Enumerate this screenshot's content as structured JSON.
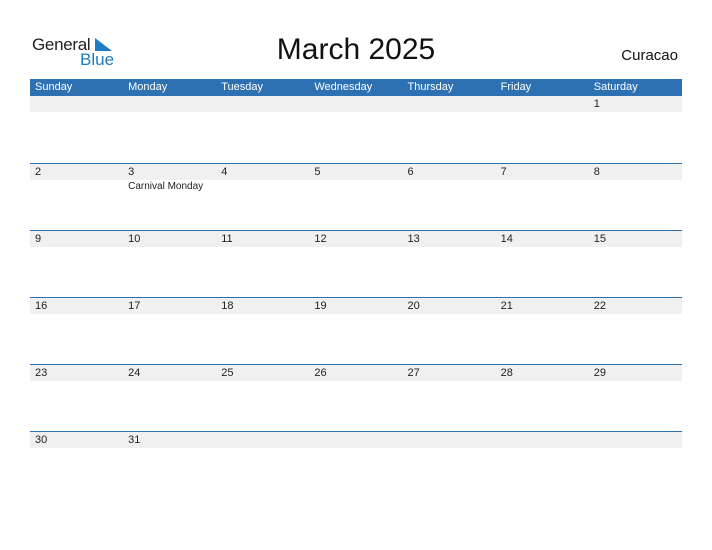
{
  "logo": {
    "line1": "General",
    "line2": "Blue"
  },
  "title": "March 2025",
  "country": "Curacao",
  "weekdays": [
    "Sunday",
    "Monday",
    "Tuesday",
    "Wednesday",
    "Thursday",
    "Friday",
    "Saturday"
  ],
  "weeks": [
    [
      {
        "d": ""
      },
      {
        "d": ""
      },
      {
        "d": ""
      },
      {
        "d": ""
      },
      {
        "d": ""
      },
      {
        "d": ""
      },
      {
        "d": "1"
      }
    ],
    [
      {
        "d": "2"
      },
      {
        "d": "3",
        "h": "Carnival Monday"
      },
      {
        "d": "4"
      },
      {
        "d": "5"
      },
      {
        "d": "6"
      },
      {
        "d": "7"
      },
      {
        "d": "8"
      }
    ],
    [
      {
        "d": "9"
      },
      {
        "d": "10"
      },
      {
        "d": "11"
      },
      {
        "d": "12"
      },
      {
        "d": "13"
      },
      {
        "d": "14"
      },
      {
        "d": "15"
      }
    ],
    [
      {
        "d": "16"
      },
      {
        "d": "17"
      },
      {
        "d": "18"
      },
      {
        "d": "19"
      },
      {
        "d": "20"
      },
      {
        "d": "21"
      },
      {
        "d": "22"
      }
    ],
    [
      {
        "d": "23"
      },
      {
        "d": "24"
      },
      {
        "d": "25"
      },
      {
        "d": "26"
      },
      {
        "d": "27"
      },
      {
        "d": "28"
      },
      {
        "d": "29"
      }
    ],
    [
      {
        "d": "30"
      },
      {
        "d": "31"
      },
      {
        "d": ""
      },
      {
        "d": ""
      },
      {
        "d": ""
      },
      {
        "d": ""
      },
      {
        "d": ""
      }
    ]
  ],
  "colors": {
    "accent": "#2e71b3",
    "strip": "#f0f0f0",
    "logo_blue": "#1e7bc4"
  }
}
